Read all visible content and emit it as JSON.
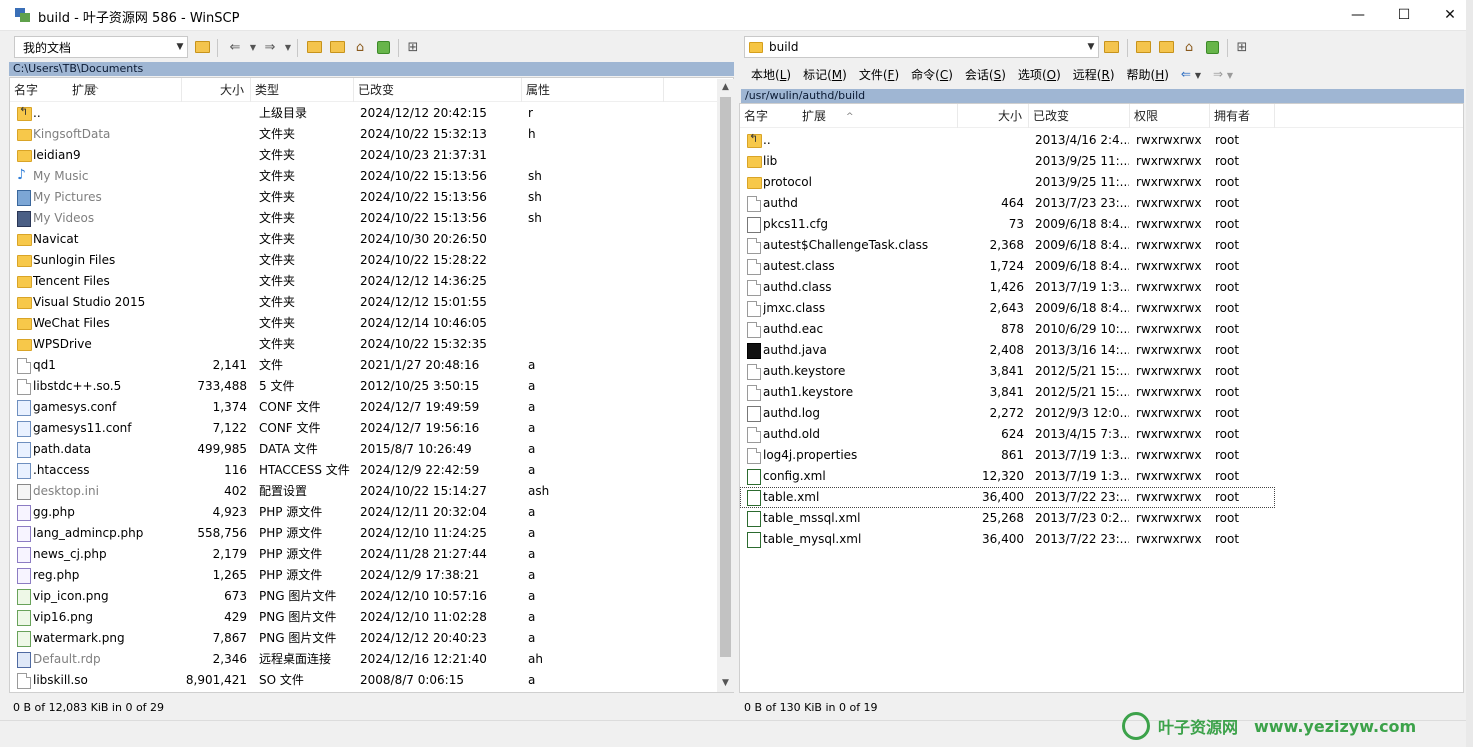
{
  "window": {
    "title": "build - 叶子资源网 586 - WinSCP",
    "minimize": "—",
    "maximize": "☐",
    "close": "✕"
  },
  "left": {
    "location": "我的文档",
    "path": "C:\\Users\\TB\\Documents",
    "columns": {
      "name": "名字",
      "ext": "扩展",
      "size": "大小",
      "type": "类型",
      "modified": "已改变",
      "attr": "属性"
    },
    "rows": [
      {
        "icon": "parent-folder-icon",
        "name": "..",
        "size": "",
        "type": "上级目录",
        "modified": "2024/12/12  20:42:15",
        "attr": "r",
        "gray": false
      },
      {
        "icon": "folder-icon",
        "name": "KingsoftData",
        "size": "",
        "type": "文件夹",
        "modified": "2024/10/22  15:32:13",
        "attr": "h",
        "gray": true
      },
      {
        "icon": "folder-icon",
        "name": "leidian9",
        "size": "",
        "type": "文件夹",
        "modified": "2024/10/23  21:37:31",
        "attr": "",
        "gray": false
      },
      {
        "icon": "music-icon",
        "name": "My Music",
        "size": "",
        "type": "文件夹",
        "modified": "2024/10/22  15:13:56",
        "attr": "sh",
        "gray": true
      },
      {
        "icon": "pictures-icon",
        "name": "My Pictures",
        "size": "",
        "type": "文件夹",
        "modified": "2024/10/22  15:13:56",
        "attr": "sh",
        "gray": true
      },
      {
        "icon": "videos-icon",
        "name": "My Videos",
        "size": "",
        "type": "文件夹",
        "modified": "2024/10/22  15:13:56",
        "attr": "sh",
        "gray": true
      },
      {
        "icon": "folder-icon",
        "name": "Navicat",
        "size": "",
        "type": "文件夹",
        "modified": "2024/10/30  20:26:50",
        "attr": "",
        "gray": false
      },
      {
        "icon": "folder-icon",
        "name": "Sunlogin Files",
        "size": "",
        "type": "文件夹",
        "modified": "2024/10/22  15:28:22",
        "attr": "",
        "gray": false
      },
      {
        "icon": "folder-icon",
        "name": "Tencent Files",
        "size": "",
        "type": "文件夹",
        "modified": "2024/12/12  14:36:25",
        "attr": "",
        "gray": false
      },
      {
        "icon": "folder-icon",
        "name": "Visual Studio 2015",
        "size": "",
        "type": "文件夹",
        "modified": "2024/12/12  15:01:55",
        "attr": "",
        "gray": false
      },
      {
        "icon": "folder-icon",
        "name": "WeChat Files",
        "size": "",
        "type": "文件夹",
        "modified": "2024/12/14  10:46:05",
        "attr": "",
        "gray": false
      },
      {
        "icon": "folder-icon",
        "name": "WPSDrive",
        "size": "",
        "type": "文件夹",
        "modified": "2024/10/22  15:32:35",
        "attr": "",
        "gray": false
      },
      {
        "icon": "file-icon",
        "name": "qd1",
        "size": "2,141",
        "type": "文件",
        "modified": "2021/1/27  20:48:16",
        "attr": "a",
        "gray": false
      },
      {
        "icon": "file-icon",
        "name": "libstdc++.so.5",
        "size": "733,488",
        "type": "5 文件",
        "modified": "2012/10/25  3:50:15",
        "attr": "a",
        "gray": false
      },
      {
        "icon": "conf-file-icon",
        "name": "gamesys.conf",
        "size": "1,374",
        "type": "CONF 文件",
        "modified": "2024/12/7  19:49:59",
        "attr": "a",
        "gray": false
      },
      {
        "icon": "conf-file-icon",
        "name": "gamesys11.conf",
        "size": "7,122",
        "type": "CONF 文件",
        "modified": "2024/12/7  19:56:16",
        "attr": "a",
        "gray": false
      },
      {
        "icon": "conf-file-icon",
        "name": "path.data",
        "size": "499,985",
        "type": "DATA 文件",
        "modified": "2015/8/7  10:26:49",
        "attr": "a",
        "gray": false
      },
      {
        "icon": "conf-file-icon",
        "name": ".htaccess",
        "size": "116",
        "type": "HTACCESS 文件",
        "modified": "2024/12/9  22:42:59",
        "attr": "a",
        "gray": false
      },
      {
        "icon": "ini-file-icon",
        "name": "desktop.ini",
        "size": "402",
        "type": "配置设置",
        "modified": "2024/10/22  15:14:27",
        "attr": "ash",
        "gray": true
      },
      {
        "icon": "php-file-icon",
        "name": "gg.php",
        "size": "4,923",
        "type": "PHP 源文件",
        "modified": "2024/12/11  20:32:04",
        "attr": "a",
        "gray": false
      },
      {
        "icon": "php-file-icon",
        "name": "lang_admincp.php",
        "size": "558,756",
        "type": "PHP 源文件",
        "modified": "2024/12/10  11:24:25",
        "attr": "a",
        "gray": false
      },
      {
        "icon": "php-file-icon",
        "name": "news_cj.php",
        "size": "2,179",
        "type": "PHP 源文件",
        "modified": "2024/11/28  21:27:44",
        "attr": "a",
        "gray": false
      },
      {
        "icon": "php-file-icon",
        "name": "reg.php",
        "size": "1,265",
        "type": "PHP 源文件",
        "modified": "2024/12/9  17:38:21",
        "attr": "a",
        "gray": false
      },
      {
        "icon": "png-file-icon",
        "name": "vip_icon.png",
        "size": "673",
        "type": "PNG 图片文件",
        "modified": "2024/12/10  10:57:16",
        "attr": "a",
        "gray": false
      },
      {
        "icon": "png-file-icon",
        "name": "vip16.png",
        "size": "429",
        "type": "PNG 图片文件",
        "modified": "2024/12/10  11:02:28",
        "attr": "a",
        "gray": false
      },
      {
        "icon": "png-file-icon",
        "name": "watermark.png",
        "size": "7,867",
        "type": "PNG 图片文件",
        "modified": "2024/12/12  20:40:23",
        "attr": "a",
        "gray": false
      },
      {
        "icon": "rdp-file-icon",
        "name": "Default.rdp",
        "size": "2,346",
        "type": "远程桌面连接",
        "modified": "2024/12/16  12:21:40",
        "attr": "ah",
        "gray": true
      },
      {
        "icon": "file-icon",
        "name": "libskill.so",
        "size": "8,901,421",
        "type": "SO 文件",
        "modified": "2008/8/7  0:06:15",
        "attr": "a",
        "gray": false
      }
    ],
    "status": "0 B of 12,083 KiB in 0 of 29"
  },
  "right": {
    "location": "build",
    "path": "/usr/wulin/authd/build",
    "menu": [
      {
        "label": "本地",
        "key": "L"
      },
      {
        "label": "标记",
        "key": "M"
      },
      {
        "label": "文件",
        "key": "F"
      },
      {
        "label": "命令",
        "key": "C"
      },
      {
        "label": "会话",
        "key": "S"
      },
      {
        "label": "选项",
        "key": "O"
      },
      {
        "label": "远程",
        "key": "R"
      },
      {
        "label": "帮助",
        "key": "H"
      }
    ],
    "columns": {
      "name": "名字",
      "ext": "扩展",
      "size": "大小",
      "modified": "已改变",
      "rights": "权限",
      "owner": "拥有者"
    },
    "rows": [
      {
        "icon": "parent-folder-icon",
        "name": "..",
        "size": "",
        "modified": "2013/4/16 2:4...",
        "rights": "rwxrwxrwx",
        "owner": "root"
      },
      {
        "icon": "folder-icon",
        "name": "lib",
        "size": "",
        "modified": "2013/9/25 11:...",
        "rights": "rwxrwxrwx",
        "owner": "root"
      },
      {
        "icon": "folder-icon",
        "name": "protocol",
        "size": "",
        "modified": "2013/9/25 11:...",
        "rights": "rwxrwxrwx",
        "owner": "root"
      },
      {
        "icon": "file-icon",
        "name": "authd",
        "size": "464",
        "modified": "2013/7/23 23:...",
        "rights": "rwxrwxrwx",
        "owner": "root"
      },
      {
        "icon": "settings-file-icon",
        "name": "pkcs11.cfg",
        "size": "73",
        "modified": "2009/6/18 8:4...",
        "rights": "rwxrwxrwx",
        "owner": "root"
      },
      {
        "icon": "file-icon",
        "name": "autest$ChallengeTask.class",
        "size": "2,368",
        "modified": "2009/6/18 8:4...",
        "rights": "rwxrwxrwx",
        "owner": "root"
      },
      {
        "icon": "file-icon",
        "name": "autest.class",
        "size": "1,724",
        "modified": "2009/6/18 8:4...",
        "rights": "rwxrwxrwx",
        "owner": "root"
      },
      {
        "icon": "file-icon",
        "name": "authd.class",
        "size": "1,426",
        "modified": "2013/7/19 1:3...",
        "rights": "rwxrwxrwx",
        "owner": "root"
      },
      {
        "icon": "file-icon",
        "name": "jmxc.class",
        "size": "2,643",
        "modified": "2009/6/18 8:4...",
        "rights": "rwxrwxrwx",
        "owner": "root"
      },
      {
        "icon": "file-icon",
        "name": "authd.eac",
        "size": "878",
        "modified": "2010/6/29 10:...",
        "rights": "rwxrwxrwx",
        "owner": "root"
      },
      {
        "icon": "java-file-icon",
        "name": "authd.java",
        "size": "2,408",
        "modified": "2013/3/16 14:...",
        "rights": "rwxrwxrwx",
        "owner": "root"
      },
      {
        "icon": "file-icon",
        "name": "auth.keystore",
        "size": "3,841",
        "modified": "2012/5/21 15:...",
        "rights": "rwxrwxrwx",
        "owner": "root"
      },
      {
        "icon": "file-icon",
        "name": "auth1.keystore",
        "size": "3,841",
        "modified": "2012/5/21 15:...",
        "rights": "rwxrwxrwx",
        "owner": "root"
      },
      {
        "icon": "log-file-icon",
        "name": "authd.log",
        "size": "2,272",
        "modified": "2012/9/3 12:0...",
        "rights": "rwxrwxrwx",
        "owner": "root"
      },
      {
        "icon": "file-icon",
        "name": "authd.old",
        "size": "624",
        "modified": "2013/4/15 7:3...",
        "rights": "rwxrwxrwx",
        "owner": "root"
      },
      {
        "icon": "file-icon",
        "name": "log4j.properties",
        "size": "861",
        "modified": "2013/7/19 1:3...",
        "rights": "rwxrwxrwx",
        "owner": "root"
      },
      {
        "icon": "xml-file-icon",
        "name": "config.xml",
        "size": "12,320",
        "modified": "2013/7/19 1:3...",
        "rights": "rwxrwxrwx",
        "owner": "root"
      },
      {
        "icon": "xml-file-icon",
        "name": "table.xml",
        "size": "36,400",
        "modified": "2013/7/22 23:...",
        "rights": "rwxrwxrwx",
        "owner": "root"
      },
      {
        "icon": "xml-file-icon",
        "name": "table_mssql.xml",
        "size": "25,268",
        "modified": "2013/7/23 0:2...",
        "rights": "rwxrwxrwx",
        "owner": "root"
      },
      {
        "icon": "xml-file-icon",
        "name": "table_mysql.xml",
        "size": "36,400",
        "modified": "2013/7/22 23:...",
        "rights": "rwxrwxrwx",
        "owner": "root"
      }
    ],
    "focused_row": 17,
    "status": "0 B of 130 KiB in 0 of 19"
  },
  "watermark": {
    "text": "叶子资源网",
    "url": "www.yezizyw.com"
  }
}
